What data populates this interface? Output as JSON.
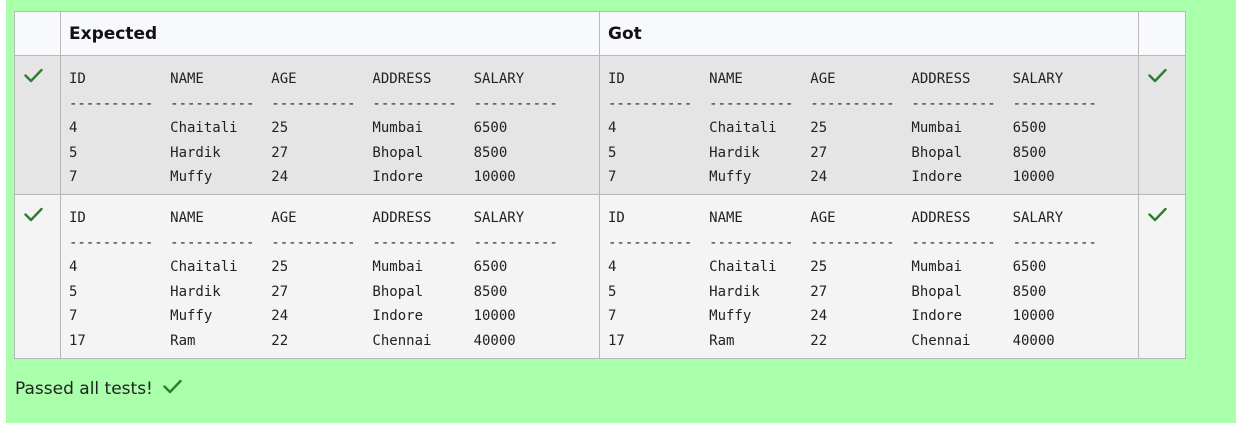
{
  "headers": {
    "expected": "Expected",
    "got": "Got"
  },
  "rows": [
    {
      "expected": "ID          NAME        AGE         ADDRESS     SALARY\n----------  ----------  ----------  ----------  ----------\n4           Chaitali    25          Mumbai      6500\n5           Hardik      27          Bhopal      8500\n7           Muffy       24          Indore      10000",
      "got": "ID          NAME        AGE         ADDRESS     SALARY\n----------  ----------  ----------  ----------  ----------\n4           Chaitali    25          Mumbai      6500\n5           Hardik      27          Bhopal      8500\n7           Muffy       24          Indore      10000"
    },
    {
      "expected": "ID          NAME        AGE         ADDRESS     SALARY\n----------  ----------  ----------  ----------  ----------\n4           Chaitali    25          Mumbai      6500\n5           Hardik      27          Bhopal      8500\n7           Muffy       24          Indore      10000\n17          Ram         22          Chennai     40000",
      "got": "ID          NAME        AGE         ADDRESS     SALARY\n----------  ----------  ----------  ----------  ----------\n4           Chaitali    25          Mumbai      6500\n5           Hardik      27          Bhopal      8500\n7           Muffy       24          Indore      10000\n17          Ram         22          Chennai     40000"
    }
  ],
  "status_text": "Passed all tests!",
  "icons": {
    "pass": "check-mark-icon"
  },
  "colors": {
    "background": "#aaffaa",
    "check": "#2e7d32"
  }
}
